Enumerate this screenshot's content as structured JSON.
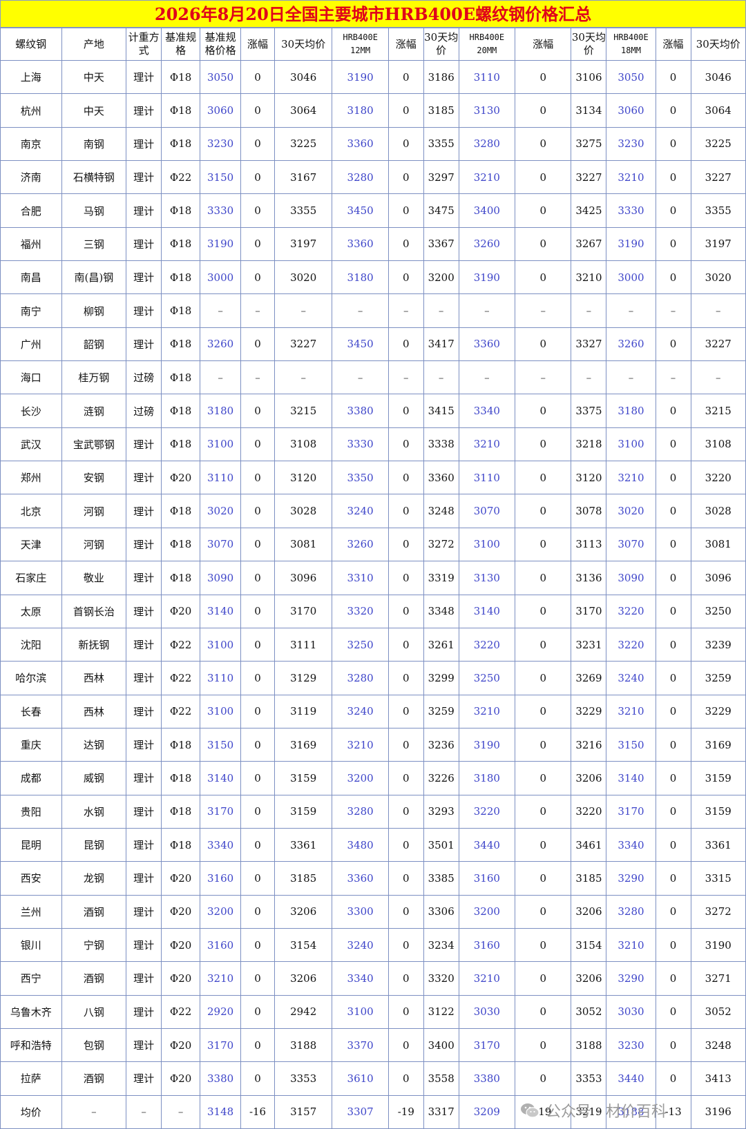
{
  "title": "2026年8月20日全国主要城市HRB400E螺纹钢价格汇总",
  "headers": [
    "螺纹钢",
    "产地",
    "计重方式",
    "基准规格",
    "基准规格价格",
    "涨幅",
    "30天均价",
    "HRB400E 12MM",
    "涨幅",
    "30天均价",
    "HRB400E 20MM",
    "涨幅",
    "30天均价",
    "HRB400E 18MM",
    "涨幅",
    "30天均价"
  ],
  "rows": [
    [
      "上海",
      "中天",
      "理计",
      "Φ18",
      "3050",
      "0",
      "3046",
      "3190",
      "0",
      "3186",
      "3110",
      "0",
      "3106",
      "3050",
      "0",
      "3046"
    ],
    [
      "杭州",
      "中天",
      "理计",
      "Φ18",
      "3060",
      "0",
      "3064",
      "3180",
      "0",
      "3185",
      "3130",
      "0",
      "3134",
      "3060",
      "0",
      "3064"
    ],
    [
      "南京",
      "南钢",
      "理计",
      "Φ18",
      "3230",
      "0",
      "3225",
      "3360",
      "0",
      "3355",
      "3280",
      "0",
      "3275",
      "3230",
      "0",
      "3225"
    ],
    [
      "济南",
      "石横特钢",
      "理计",
      "Φ22",
      "3150",
      "0",
      "3167",
      "3280",
      "0",
      "3297",
      "3210",
      "0",
      "3227",
      "3210",
      "0",
      "3227"
    ],
    [
      "合肥",
      "马钢",
      "理计",
      "Φ18",
      "3330",
      "0",
      "3355",
      "3450",
      "0",
      "3475",
      "3400",
      "0",
      "3425",
      "3330",
      "0",
      "3355"
    ],
    [
      "福州",
      "三钢",
      "理计",
      "Φ18",
      "3190",
      "0",
      "3197",
      "3360",
      "0",
      "3367",
      "3260",
      "0",
      "3267",
      "3190",
      "0",
      "3197"
    ],
    [
      "南昌",
      "南(昌)钢",
      "理计",
      "Φ18",
      "3000",
      "0",
      "3020",
      "3180",
      "0",
      "3200",
      "3190",
      "0",
      "3210",
      "3000",
      "0",
      "3020"
    ],
    [
      "南宁",
      "柳钢",
      "理计",
      "Φ18",
      "–",
      "–",
      "–",
      "–",
      "–",
      "–",
      "–",
      "–",
      "–",
      "–",
      "–",
      "–"
    ],
    [
      "广州",
      "韶钢",
      "理计",
      "Φ18",
      "3260",
      "0",
      "3227",
      "3450",
      "0",
      "3417",
      "3360",
      "0",
      "3327",
      "3260",
      "0",
      "3227"
    ],
    [
      "海口",
      "桂万钢",
      "过磅",
      "Φ18",
      "–",
      "–",
      "–",
      "–",
      "–",
      "–",
      "–",
      "–",
      "–",
      "–",
      "–",
      "–"
    ],
    [
      "长沙",
      "涟钢",
      "过磅",
      "Φ18",
      "3180",
      "0",
      "3215",
      "3380",
      "0",
      "3415",
      "3340",
      "0",
      "3375",
      "3180",
      "0",
      "3215"
    ],
    [
      "武汉",
      "宝武鄂钢",
      "理计",
      "Φ18",
      "3100",
      "0",
      "3108",
      "3330",
      "0",
      "3338",
      "3210",
      "0",
      "3218",
      "3100",
      "0",
      "3108"
    ],
    [
      "郑州",
      "安钢",
      "理计",
      "Φ20",
      "3110",
      "0",
      "3120",
      "3350",
      "0",
      "3360",
      "3110",
      "0",
      "3120",
      "3210",
      "0",
      "3220"
    ],
    [
      "北京",
      "河钢",
      "理计",
      "Φ18",
      "3020",
      "0",
      "3028",
      "3240",
      "0",
      "3248",
      "3070",
      "0",
      "3078",
      "3020",
      "0",
      "3028"
    ],
    [
      "天津",
      "河钢",
      "理计",
      "Φ18",
      "3070",
      "0",
      "3081",
      "3260",
      "0",
      "3272",
      "3100",
      "0",
      "3113",
      "3070",
      "0",
      "3081"
    ],
    [
      "石家庄",
      "敬业",
      "理计",
      "Φ18",
      "3090",
      "0",
      "3096",
      "3310",
      "0",
      "3319",
      "3130",
      "0",
      "3136",
      "3090",
      "0",
      "3096"
    ],
    [
      "太原",
      "首钢长治",
      "理计",
      "Φ20",
      "3140",
      "0",
      "3170",
      "3320",
      "0",
      "3348",
      "3140",
      "0",
      "3170",
      "3220",
      "0",
      "3250"
    ],
    [
      "沈阳",
      "新抚钢",
      "理计",
      "Φ22",
      "3100",
      "0",
      "3111",
      "3250",
      "0",
      "3261",
      "3220",
      "0",
      "3231",
      "3220",
      "0",
      "3239"
    ],
    [
      "哈尔滨",
      "西林",
      "理计",
      "Φ22",
      "3110",
      "0",
      "3129",
      "3280",
      "0",
      "3299",
      "3250",
      "0",
      "3269",
      "3240",
      "0",
      "3259"
    ],
    [
      "长春",
      "西林",
      "理计",
      "Φ22",
      "3100",
      "0",
      "3119",
      "3240",
      "0",
      "3259",
      "3210",
      "0",
      "3229",
      "3210",
      "0",
      "3229"
    ],
    [
      "重庆",
      "达钢",
      "理计",
      "Φ18",
      "3150",
      "0",
      "3169",
      "3210",
      "0",
      "3236",
      "3190",
      "0",
      "3216",
      "3150",
      "0",
      "3169"
    ],
    [
      "成都",
      "威钢",
      "理计",
      "Φ18",
      "3140",
      "0",
      "3159",
      "3200",
      "0",
      "3226",
      "3180",
      "0",
      "3206",
      "3140",
      "0",
      "3159"
    ],
    [
      "贵阳",
      "水钢",
      "理计",
      "Φ18",
      "3170",
      "0",
      "3159",
      "3280",
      "0",
      "3293",
      "3220",
      "0",
      "3220",
      "3170",
      "0",
      "3159"
    ],
    [
      "昆明",
      "昆钢",
      "理计",
      "Φ18",
      "3340",
      "0",
      "3361",
      "3480",
      "0",
      "3501",
      "3440",
      "0",
      "3461",
      "3340",
      "0",
      "3361"
    ],
    [
      "西安",
      "龙钢",
      "理计",
      "Φ20",
      "3160",
      "0",
      "3185",
      "3360",
      "0",
      "3385",
      "3160",
      "0",
      "3185",
      "3290",
      "0",
      "3315"
    ],
    [
      "兰州",
      "酒钢",
      "理计",
      "Φ20",
      "3200",
      "0",
      "3206",
      "3300",
      "0",
      "3306",
      "3200",
      "0",
      "3206",
      "3280",
      "0",
      "3272"
    ],
    [
      "银川",
      "宁钢",
      "理计",
      "Φ20",
      "3160",
      "0",
      "3154",
      "3240",
      "0",
      "3234",
      "3160",
      "0",
      "3154",
      "3210",
      "0",
      "3190"
    ],
    [
      "西宁",
      "酒钢",
      "理计",
      "Φ20",
      "3210",
      "0",
      "3206",
      "3340",
      "0",
      "3320",
      "3210",
      "0",
      "3206",
      "3290",
      "0",
      "3271"
    ],
    [
      "乌鲁木齐",
      "八钢",
      "理计",
      "Φ22",
      "2920",
      "0",
      "2942",
      "3100",
      "0",
      "3122",
      "3030",
      "0",
      "3052",
      "3030",
      "0",
      "3052"
    ],
    [
      "呼和浩特",
      "包钢",
      "理计",
      "Φ20",
      "3170",
      "0",
      "3188",
      "3370",
      "0",
      "3400",
      "3170",
      "0",
      "3188",
      "3230",
      "0",
      "3248"
    ],
    [
      "拉萨",
      "酒钢",
      "理计",
      "Φ20",
      "3380",
      "0",
      "3353",
      "3610",
      "0",
      "3558",
      "3380",
      "0",
      "3353",
      "3440",
      "0",
      "3413"
    ],
    [
      "均价",
      "–",
      "–",
      "–",
      "3148",
      "-16",
      "3157",
      "3307",
      "-19",
      "3317",
      "3209",
      "-19",
      "3219",
      "3188",
      "-13",
      "3196"
    ]
  ],
  "watermark": "公众号 · 材价百科",
  "watermark_icon": "wechat-icon",
  "colors": {
    "title_bg": "#ffff00",
    "title_text": "#e0001a",
    "price_text": "#3d44c9",
    "border": "#7c8fc2"
  }
}
